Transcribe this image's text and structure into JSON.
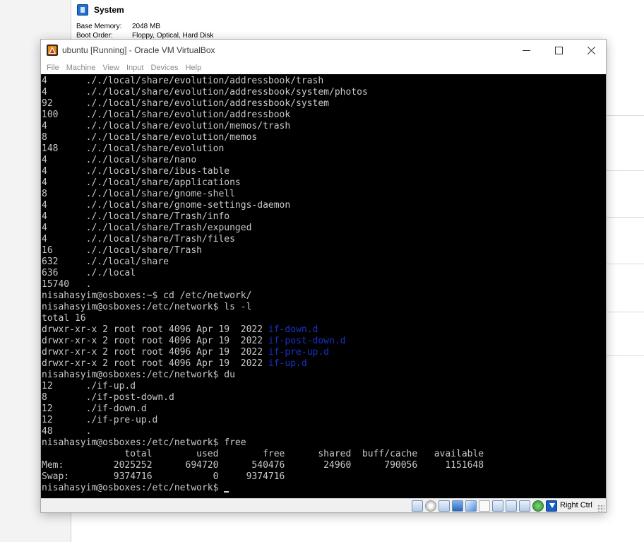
{
  "background": {
    "section_title": "System",
    "properties": [
      {
        "key": "Base Memory:",
        "value": "2048 MB"
      },
      {
        "key": "Boot Order:",
        "value": "Floppy, Optical, Hard Disk"
      }
    ]
  },
  "window": {
    "title": "ubuntu [Running] - Oracle VM VirtualBox",
    "controls": {
      "minimize": "—",
      "maximize": "☐",
      "close": "✕"
    }
  },
  "menu": [
    "File",
    "Machine",
    "View",
    "Input",
    "Devices",
    "Help"
  ],
  "terminal": {
    "lines": [
      {
        "text": "4       ././local/share/evolution/addressbook/trash"
      },
      {
        "text": "4       ././local/share/evolution/addressbook/system/photos"
      },
      {
        "text": "92      ././local/share/evolution/addressbook/system"
      },
      {
        "text": "100     ././local/share/evolution/addressbook"
      },
      {
        "text": "4       ././local/share/evolution/memos/trash"
      },
      {
        "text": "8       ././local/share/evolution/memos"
      },
      {
        "text": "148     ././local/share/evolution"
      },
      {
        "text": "4       ././local/share/nano"
      },
      {
        "text": "4       ././local/share/ibus-table"
      },
      {
        "text": "4       ././local/share/applications"
      },
      {
        "text": "8       ././local/share/gnome-shell"
      },
      {
        "text": "4       ././local/share/gnome-settings-daemon"
      },
      {
        "text": "4       ././local/share/Trash/info"
      },
      {
        "text": "4       ././local/share/Trash/expunged"
      },
      {
        "text": "4       ././local/share/Trash/files"
      },
      {
        "text": "16      ././local/share/Trash"
      },
      {
        "text": "632     ././local/share"
      },
      {
        "text": "636     ././local"
      },
      {
        "text": "15740   ."
      },
      {
        "text": "nisahasyim@osboxes:~$ cd /etc/network/"
      },
      {
        "text": "nisahasyim@osboxes:/etc/network$ ls -l"
      },
      {
        "text": "total 16"
      },
      {
        "text": "drwxr-xr-x 2 root root 4096 Apr 19  2022 ",
        "dir": "if-down.d"
      },
      {
        "text": "drwxr-xr-x 2 root root 4096 Apr 19  2022 ",
        "dir": "if-post-down.d"
      },
      {
        "text": "drwxr-xr-x 2 root root 4096 Apr 19  2022 ",
        "dir": "if-pre-up.d"
      },
      {
        "text": "drwxr-xr-x 2 root root 4096 Apr 19  2022 ",
        "dir": "if-up.d"
      },
      {
        "text": "nisahasyim@osboxes:/etc/network$ du"
      },
      {
        "text": "12      ./if-up.d"
      },
      {
        "text": "8       ./if-post-down.d"
      },
      {
        "text": "12      ./if-down.d"
      },
      {
        "text": "12      ./if-pre-up.d"
      },
      {
        "text": "48      ."
      },
      {
        "text": "nisahasyim@osboxes:/etc/network$ free"
      },
      {
        "text": "               total        used        free      shared  buff/cache   available"
      },
      {
        "text": "Mem:         2025252      694720      540476       24960      790056     1151648"
      },
      {
        "text": "Swap:        9374716           0     9374716"
      },
      {
        "text": "nisahasyim@osboxes:/etc/network$ ",
        "cursor": true
      }
    ]
  },
  "statusbar": {
    "icons": [
      "hard-disk-icon",
      "optical-drive-icon",
      "audio-icon",
      "network-icon",
      "usb-icon",
      "shared-folders-icon",
      "display-icon",
      "video-capture-icon",
      "recording-icon",
      "cpu-icon",
      "guest-additions-icon",
      "mouse-integration-icon",
      "keyboard-capture-icon"
    ],
    "host_key": "Right Ctrl"
  }
}
